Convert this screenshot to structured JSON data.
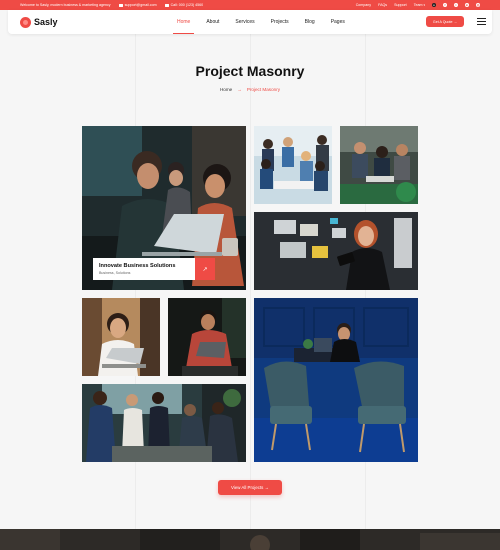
{
  "topbar": {
    "welcome": "Welcome to Sasly, modern business & marketing agency",
    "email": "support@gmail.com",
    "phone": "Call: 000 (123) 4560",
    "links": [
      "Company",
      "FAQs",
      "Support",
      "Team"
    ],
    "socials": [
      {
        "icon": "user-icon",
        "glyph": "●"
      },
      {
        "icon": "facebook-icon",
        "glyph": "f"
      },
      {
        "icon": "twitter-icon",
        "glyph": "t"
      },
      {
        "icon": "linkedin-icon",
        "glyph": "in"
      },
      {
        "icon": "instagram-icon",
        "glyph": "◎"
      }
    ]
  },
  "header": {
    "logo_text": "Sasly",
    "nav": [
      {
        "label": "Home",
        "active": true
      },
      {
        "label": "About"
      },
      {
        "label": "Services"
      },
      {
        "label": "Projects"
      },
      {
        "label": "Blog"
      },
      {
        "label": "Pages"
      }
    ],
    "cta_label": "Get A Quote →"
  },
  "page": {
    "title": "Project Masonry",
    "breadcrumb_home": "Home",
    "breadcrumb_sep": "→",
    "breadcrumb_current": "Project Masonry"
  },
  "featured": {
    "title": "Innovate Business Solutions",
    "subtitle": "Business, Solutions",
    "arrow": "↗"
  },
  "view_all_label": "View All Projects →",
  "colors": {
    "accent": "#ef4b45",
    "background": "#f6f6f6",
    "dark_blue": "#10357a"
  }
}
